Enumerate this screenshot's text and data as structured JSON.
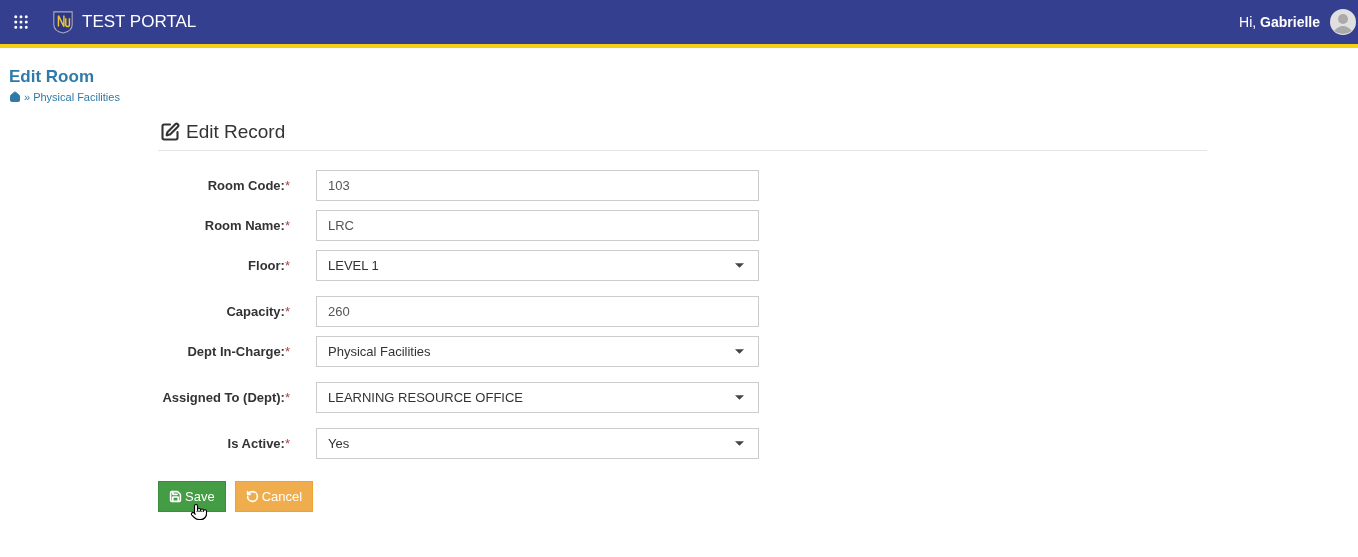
{
  "header": {
    "title": "TEST PORTAL",
    "greeting": "Hi, ",
    "user": "Gabrielle"
  },
  "page": {
    "title": "Edit Room",
    "breadcrumb": [
      {
        "label": "Physical Facilities"
      }
    ],
    "separator": "»"
  },
  "form": {
    "heading": "Edit Record",
    "fields": [
      {
        "label": "Room Code:",
        "mark": "*",
        "kind": "text",
        "value": "103"
      },
      {
        "label": "Room Name:",
        "mark": "*",
        "kind": "text",
        "value": "LRC"
      },
      {
        "label": "Floor:",
        "mark": "*",
        "kind": "select",
        "value": "LEVEL 1"
      },
      {
        "label": "Capacity:",
        "mark": "*",
        "kind": "text",
        "value": "260"
      },
      {
        "label": "Dept In-Charge:",
        "mark": "*",
        "kind": "select",
        "value": "Physical Facilities"
      },
      {
        "label": "Assigned To (Dept):",
        "mark": "*",
        "kind": "select",
        "value": "LEARNING RESOURCE OFFICE"
      },
      {
        "label": "Is Active:",
        "mark": "*",
        "kind": "select",
        "value": "Yes"
      }
    ],
    "buttons": [
      {
        "label": "Save",
        "kind": "save"
      },
      {
        "label": "Cancel",
        "kind": "cancel"
      }
    ]
  }
}
